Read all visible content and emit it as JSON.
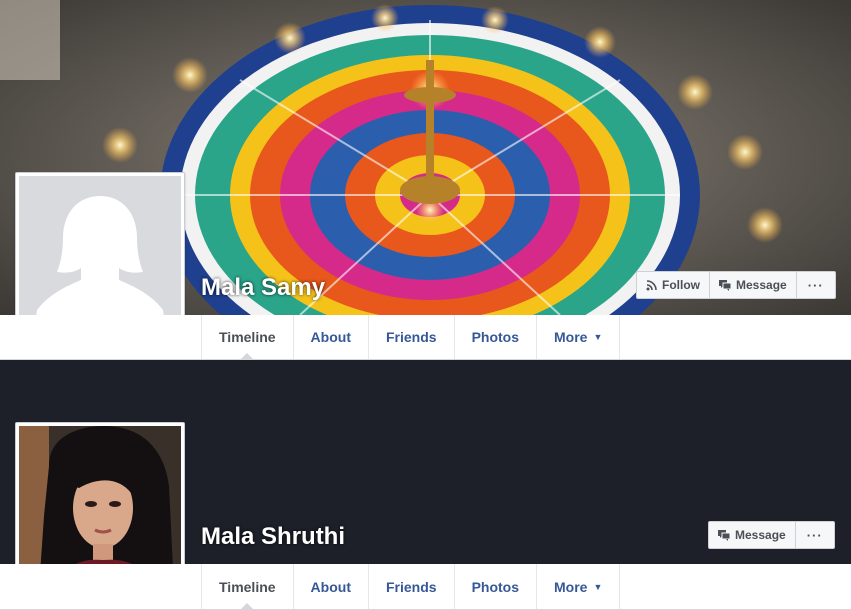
{
  "profiles": [
    {
      "name": "Mala Samy",
      "actions": {
        "follow": "Follow",
        "message": "Message",
        "more": "···"
      },
      "tabs": [
        "Timeline",
        "About",
        "Friends",
        "Photos",
        "More"
      ]
    },
    {
      "name": "Mala Shruthi",
      "actions": {
        "message": "Message",
        "more": "···"
      },
      "tabs": [
        "Timeline",
        "About",
        "Friends",
        "Photos",
        "More"
      ]
    }
  ],
  "colors": {
    "link": "#365899",
    "active_tab": "#4b4f56",
    "cover_dark": "#1d2029"
  },
  "icons": [
    "rss-follow-icon",
    "message-icon",
    "more-dots-icon",
    "caret-down-icon",
    "default-avatar-icon"
  ]
}
